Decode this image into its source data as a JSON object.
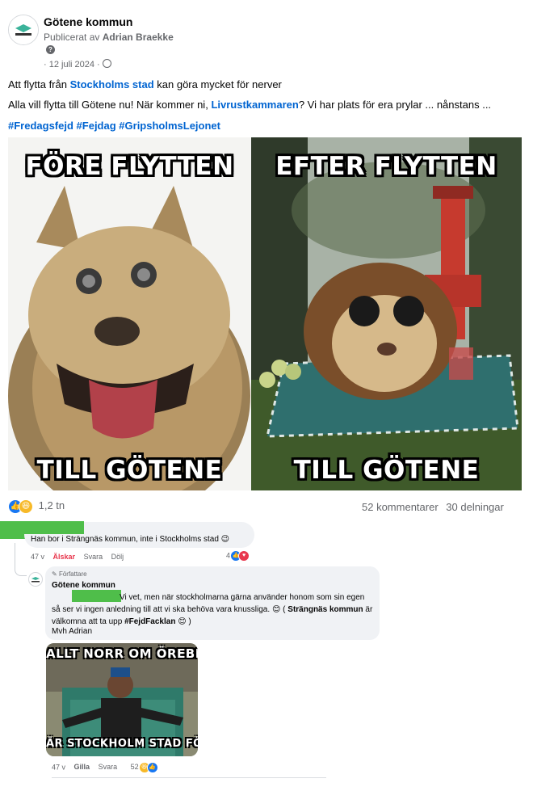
{
  "post": {
    "page_name": "Götene kommun",
    "published_by_prefix": "Publicerat av",
    "published_by_name": "Adrian Braekke",
    "date": "· 12 juli 2024 ·",
    "line1_part1": "Att flytta från",
    "line1_link": "Stockholms stad",
    "line1_part2": "kan göra mycket för nerver",
    "line2_part1": "Alla vill flytta till Götene nu! När kommer ni,",
    "line2_link": "Livrustkammaren",
    "line2_part2": "? Vi har plats för era prylar ... nånstans ...",
    "hashtags": [
      "#Fredagsfejd",
      "#Fejdag",
      "#GripsholmsLejonet"
    ],
    "meme": {
      "left_top": "FÖRE FLYTTEN",
      "left_bottom": "TILL GÖTENE",
      "right_top": "EFTER FLYTTEN",
      "right_bottom": "TILL GÖTENE"
    },
    "reactions_count": "1,2 tn",
    "comments_count": "52 kommentarer",
    "shares_count": "30 delningar"
  },
  "comment1": {
    "text": "Han bor i Strängnäs kommun, inte i Stockholms stad",
    "emoji": "😉",
    "time": "47 v",
    "like_label": "Älskar",
    "reply_label": "Svara",
    "hide_label": "Dölj",
    "reaction_count": "4"
  },
  "reply1": {
    "badge": "Författare",
    "author": "Götene kommun",
    "text_part1": "Vi vet, men när stockholmarna gärna använder honom som sin egen så ser vi ingen anledning till att vi ska behöva vara knussliga.",
    "emoji": "😊",
    "text_part2_prefix": "(",
    "mention": "Strängnäs kommun",
    "text_part3": "är välkomna att ta upp",
    "hashtag": "#FejdFacklan",
    "text_part4": ")",
    "signature": "Mvh Adrian",
    "gif_top": "ALLT NORR OM ÖREBRO",
    "gif_bottom": "ÄR STOCKHOLM STAD FÖR OSS",
    "time": "47 v",
    "like_label": "Gilla",
    "reply_label": "Svara",
    "reaction_count": "52"
  },
  "colors": {
    "link_blue": "#0064d1",
    "redaction_green": "#4fbe4a",
    "love_red": "#e8374d",
    "like_blue": "#1877f2"
  }
}
